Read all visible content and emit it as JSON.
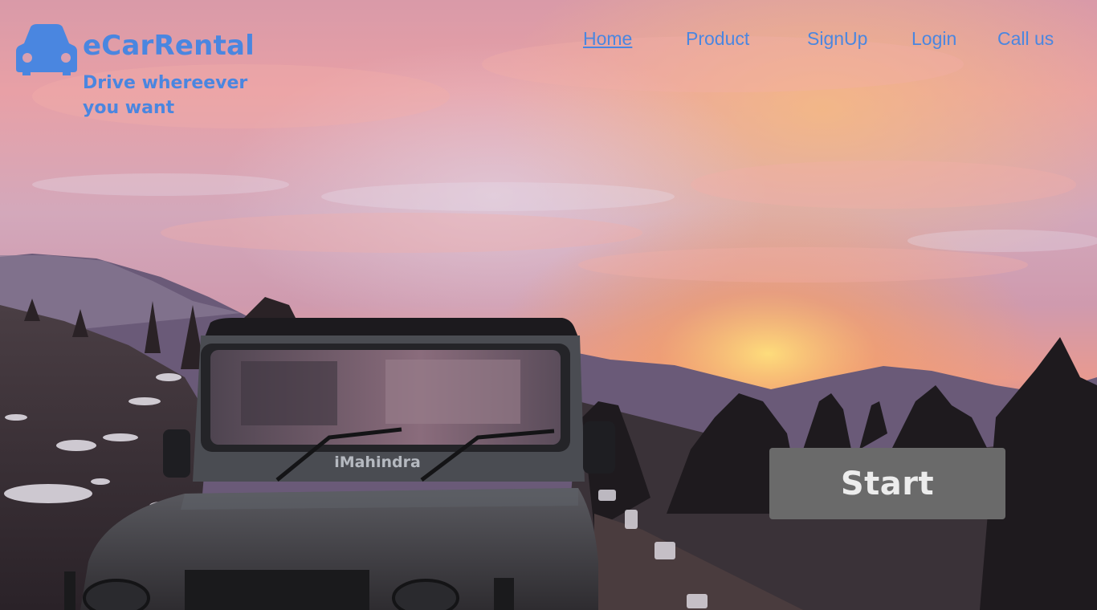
{
  "brand": {
    "name": "eCarRental",
    "tagline": "Drive whereever you want",
    "color": "#4a86e0",
    "logo_icon": "car-icon"
  },
  "nav": {
    "items": [
      {
        "label": "Home",
        "active": true
      },
      {
        "label": "Product",
        "active": false
      },
      {
        "label": "SignUp",
        "active": false
      },
      {
        "label": "Login",
        "active": false
      },
      {
        "label": "Call us",
        "active": false
      }
    ]
  },
  "hero": {
    "start_label": "Start",
    "button_color": "#6a6a6a"
  }
}
